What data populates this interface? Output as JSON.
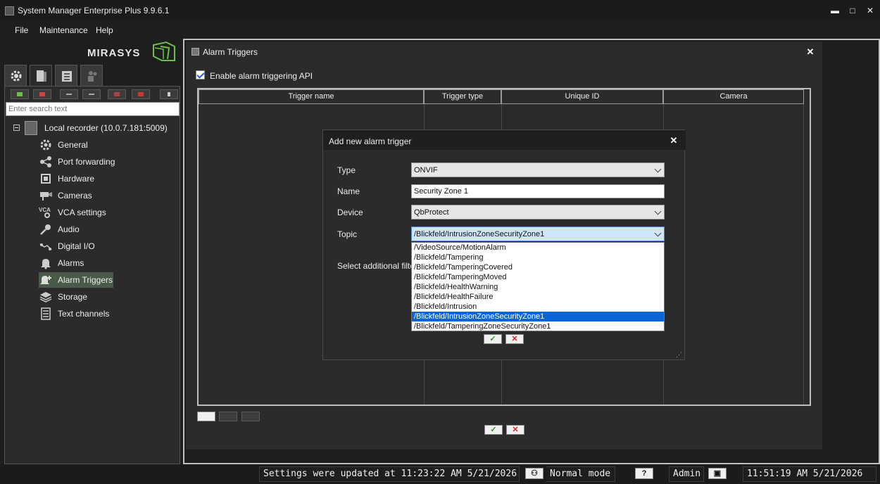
{
  "app": {
    "title": "System Manager Enterprise Plus 9.9.6.1"
  },
  "window_controls": {
    "minimize": "▬",
    "maximize": "□",
    "close": "✕"
  },
  "menu": {
    "file": "File",
    "maintenance": "Maintenance",
    "help": "Help"
  },
  "logo": {
    "text": "MIRASYS"
  },
  "sidebar": {
    "search_placeholder": "Enter search text",
    "root_label": "Local recorder (10.0.7.181:5009)",
    "items": [
      {
        "label": "General",
        "icon": "gear-icon"
      },
      {
        "label": "Port forwarding",
        "icon": "share-icon"
      },
      {
        "label": "Hardware",
        "icon": "chip-icon"
      },
      {
        "label": "Cameras",
        "icon": "camera-icon"
      },
      {
        "label": "VCA settings",
        "icon": "vca-icon"
      },
      {
        "label": "Audio",
        "icon": "microphone-icon"
      },
      {
        "label": "Digital I/O",
        "icon": "digital-io-icon"
      },
      {
        "label": "Alarms",
        "icon": "bell-icon"
      },
      {
        "label": "Alarm Triggers",
        "icon": "bell-plus-icon",
        "selected": true
      },
      {
        "label": "Storage",
        "icon": "layers-icon"
      },
      {
        "label": "Text channels",
        "icon": "list-icon"
      }
    ]
  },
  "main": {
    "title": "Alarm Triggers",
    "enable_label": "Enable alarm triggering API",
    "enable_checked": true,
    "columns": [
      "Trigger name",
      "Trigger type",
      "Unique ID",
      "Camera"
    ]
  },
  "dialog": {
    "title": "Add new alarm trigger",
    "type_label": "Type",
    "type_value": "ONVIF",
    "name_label": "Name",
    "name_value": "Security Zone 1",
    "device_label": "Device",
    "device_value": "QbProtect",
    "topic_label": "Topic",
    "topic_value": "/Blickfeld/IntrusionZoneSecurityZone1",
    "filter_label": "Select additional filte",
    "topic_options": [
      "/VideoSource/MotionAlarm",
      "/Blickfeld/Tampering",
      "/Blickfeld/TamperingCovered",
      "/Blickfeld/TamperingMoved",
      "/Blickfeld/HealthWarning",
      "/Blickfeld/HealthFailure",
      "/Blickfeld/Intrusion",
      "/Blickfeld/IntrusionZoneSecurityZone1",
      "/Blickfeld/TamperingZoneSecurityZone1"
    ],
    "selected_option_index": 7,
    "ok": "✓",
    "cancel": "✕"
  },
  "footer": {
    "ok": "✓",
    "cancel": "✕"
  },
  "statusbar": {
    "message": "Settings were updated at 11:23:22 AM 5/21/2026",
    "mode": "Normal mode",
    "help": "?",
    "user": "Admin",
    "clock": "11:51:19 AM 5/21/2026"
  },
  "colors": {
    "accent_green": "#6cc04a",
    "selection_blue": "#0a66d6",
    "tree_selected": "#4a5a48"
  }
}
